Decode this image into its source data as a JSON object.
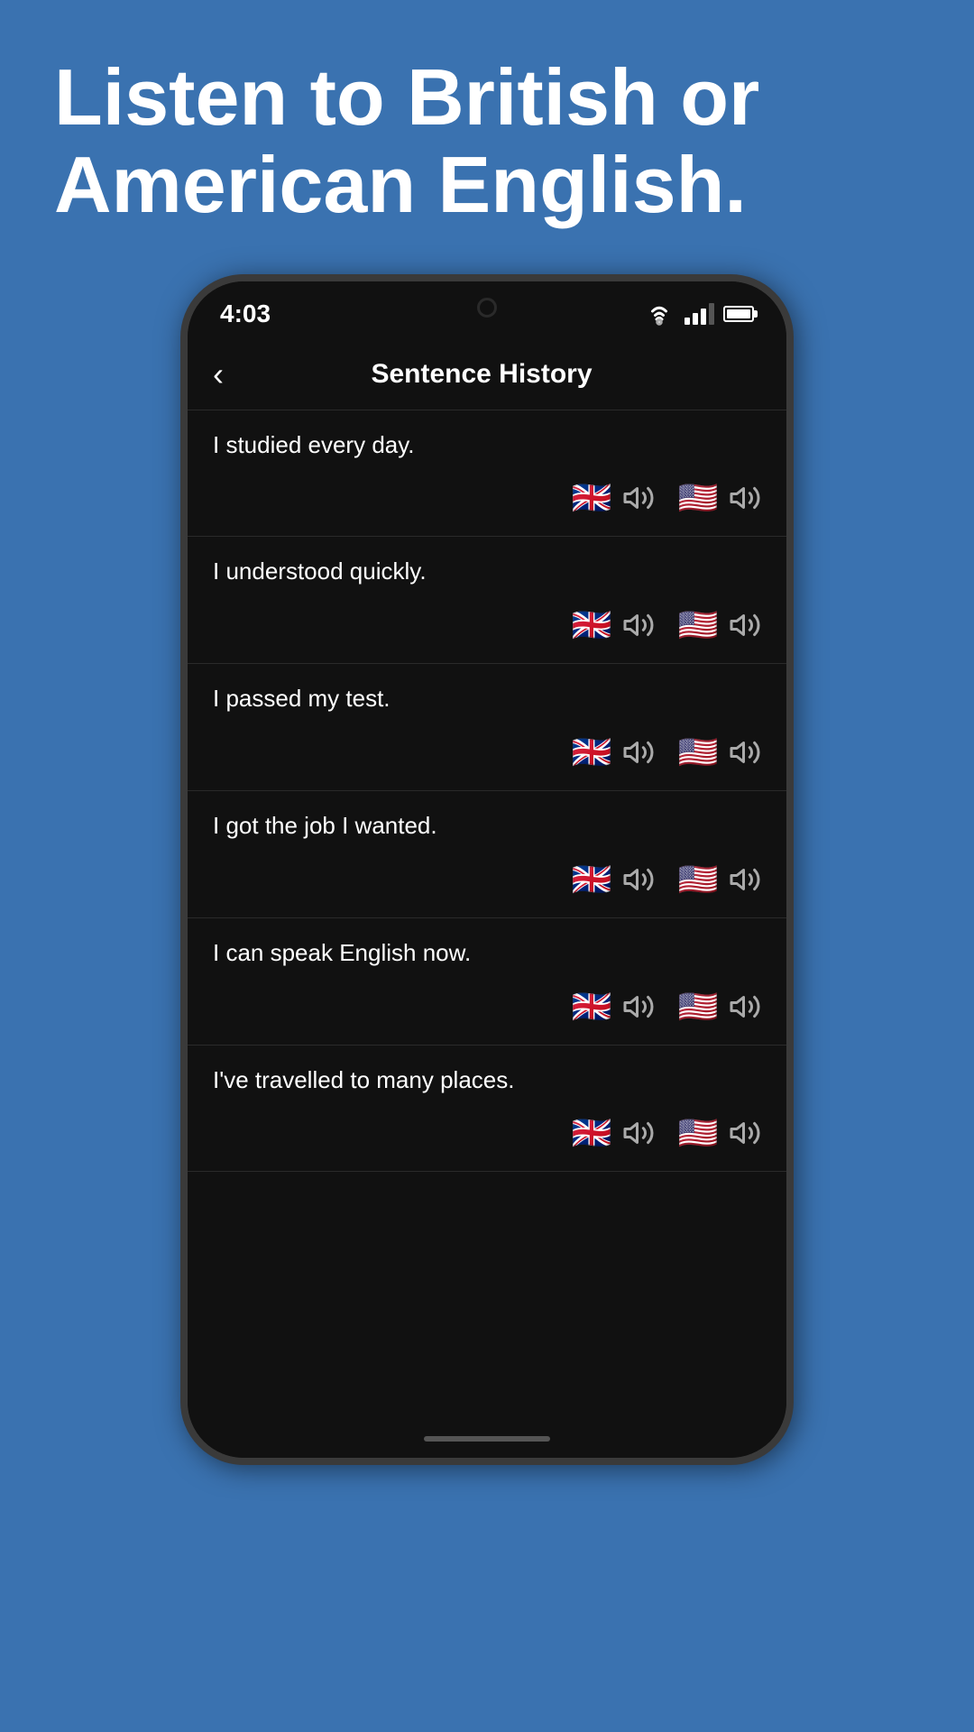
{
  "hero": {
    "text": "Listen to British or American English."
  },
  "status_bar": {
    "time": "4:03"
  },
  "header": {
    "title": "Sentence History",
    "back_label": "<"
  },
  "sentences": [
    {
      "id": 1,
      "text": "I studied every day."
    },
    {
      "id": 2,
      "text": "I understood quickly."
    },
    {
      "id": 3,
      "text": "I passed my test."
    },
    {
      "id": 4,
      "text": "I got the job I wanted."
    },
    {
      "id": 5,
      "text": "I can speak English now."
    },
    {
      "id": 6,
      "text": "I've travelled to many places."
    }
  ],
  "flags": {
    "british": "🇬🇧",
    "american": "🇺🇸"
  },
  "icons": {
    "back": "❮",
    "speaker": "speaker-icon",
    "wifi": "wifi-icon",
    "signal": "signal-icon",
    "battery": "battery-icon"
  }
}
